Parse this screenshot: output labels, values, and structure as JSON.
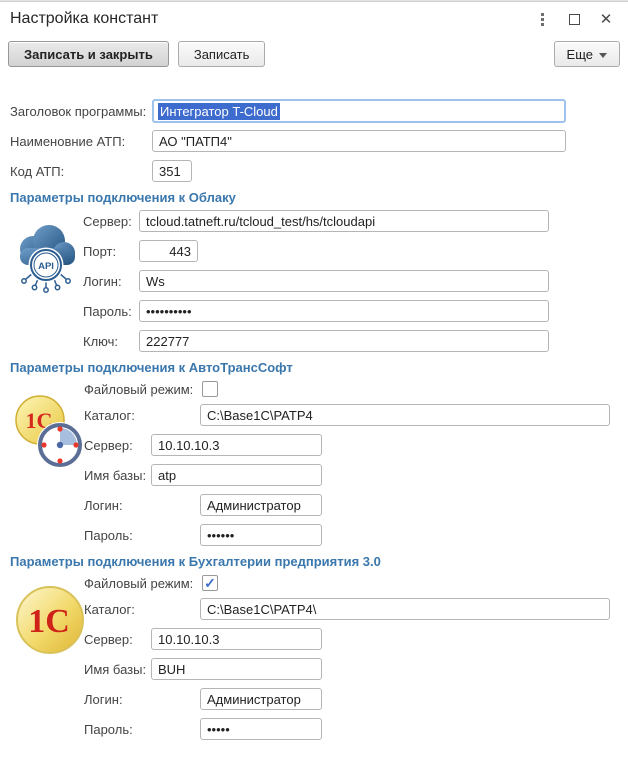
{
  "window": {
    "title": "Настройка констант",
    "close_icon_glyph": "✕"
  },
  "toolbar": {
    "save_close_label": "Записать и закрыть",
    "save_label": "Записать",
    "more_label": "Еще"
  },
  "general": {
    "app_title": {
      "label": "Заголовок программы:",
      "value": "Интегратор T-Cloud"
    },
    "atp_name": {
      "label": "Наименовние АТП:",
      "value": "АО \"ПАТП4\""
    },
    "atp_code": {
      "label": "Код АТП:",
      "value": "351"
    }
  },
  "cloud": {
    "title": "Параметры подключения к Облаку",
    "api_text": "API",
    "server": {
      "label": "Сервер:",
      "value": "tcloud.tatneft.ru/tcloud_test/hs/tcloudapi"
    },
    "port": {
      "label": "Порт:",
      "value": "443"
    },
    "login": {
      "label": "Логин:",
      "value": "Ws"
    },
    "password": {
      "label": "Пароль:",
      "value": "••••••••••"
    },
    "key": {
      "label": "Ключ:",
      "value": "222777"
    }
  },
  "ats": {
    "title": "Параметры подключения к АвтоТрансСофт",
    "logo_text": "1С",
    "file_mode": {
      "label": "Файловый режим:",
      "checked": false,
      "check_glyph": ""
    },
    "catalog": {
      "label": "Каталог:",
      "value": "C:\\Base1C\\PATP4"
    },
    "server": {
      "label": "Сервер:",
      "value": "10.10.10.3"
    },
    "db_name": {
      "label": "Имя базы:",
      "value": "atp"
    },
    "login": {
      "label": "Логин:",
      "value": "Администратор"
    },
    "password": {
      "label": "Пароль:",
      "value": "••••••"
    }
  },
  "buh": {
    "title": "Параметры подключения к Бухгалтерии предприятия 3.0",
    "logo_text": "1С",
    "file_mode": {
      "label": "Файловый режим:",
      "checked": true,
      "check_glyph": "✓"
    },
    "catalog": {
      "label": "Каталог:",
      "value": "C:\\Base1C\\PATP4\\"
    },
    "server": {
      "label": "Сервер:",
      "value": "10.10.10.3"
    },
    "db_name": {
      "label": "Имя базы:",
      "value": "BUH"
    },
    "login": {
      "label": "Логин:",
      "value": "Администратор"
    },
    "password": {
      "label": "Пароль:",
      "value": "•••••"
    }
  }
}
